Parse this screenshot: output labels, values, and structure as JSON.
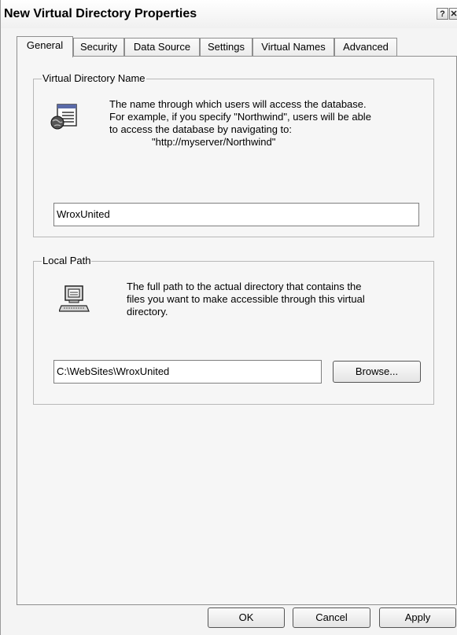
{
  "dialog": {
    "title": "New Virtual Directory Properties",
    "help_glyph": "?",
    "close_glyph": "✕"
  },
  "tabs": [
    {
      "label": "General",
      "active": true
    },
    {
      "label": "Security",
      "active": false
    },
    {
      "label": "Data Source",
      "active": false
    },
    {
      "label": "Settings",
      "active": false
    },
    {
      "label": "Virtual Names",
      "active": false
    },
    {
      "label": "Advanced",
      "active": false
    }
  ],
  "vdir": {
    "legend": "Virtual Directory Name",
    "icon": "web-document-globe-icon",
    "desc_lines": [
      "The name through which users will access the database.",
      "For example, if you specify \"Northwind\", users will be able",
      "to access the database by navigating to:",
      "\"http://myserver/Northwind\""
    ],
    "value": "WroxUnited"
  },
  "local_path": {
    "legend": "Local Path",
    "icon": "computer-icon",
    "desc_lines": [
      "The full path to the actual directory that contains the",
      "files you want to make accessible through this virtual",
      "directory."
    ],
    "value": "C:\\WebSites\\WroxUnited",
    "browse_label": "Browse..."
  },
  "footer": {
    "ok_label": "OK",
    "cancel_label": "Cancel",
    "apply_label": "Apply"
  },
  "colors": {
    "dialog_bg": "#f4f4f4",
    "border": "#8e8e8e"
  }
}
